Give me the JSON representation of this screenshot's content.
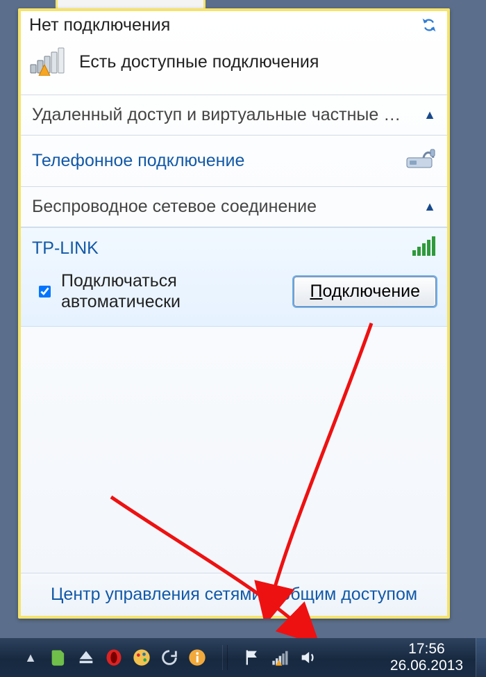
{
  "header": {
    "title": "Нет подключения"
  },
  "available": {
    "text": "Есть доступные подключения"
  },
  "sections": {
    "vpn": {
      "label": "Удаленный доступ и виртуальные частные се..."
    },
    "dialup": {
      "label": "Телефонное подключение"
    },
    "wireless": {
      "label": "Беспроводное сетевое соединение"
    }
  },
  "wifi": {
    "ssid": "TP-LINK",
    "auto_label_line1": "Подключаться",
    "auto_label_line2": "автоматически",
    "auto_checked": true,
    "connect_btn_u": "П",
    "connect_btn_rest": "одключение"
  },
  "footer": {
    "link": "Центр управления сетями и общим доступом"
  },
  "clock": {
    "time": "17:56",
    "date": "26.06.2013"
  }
}
